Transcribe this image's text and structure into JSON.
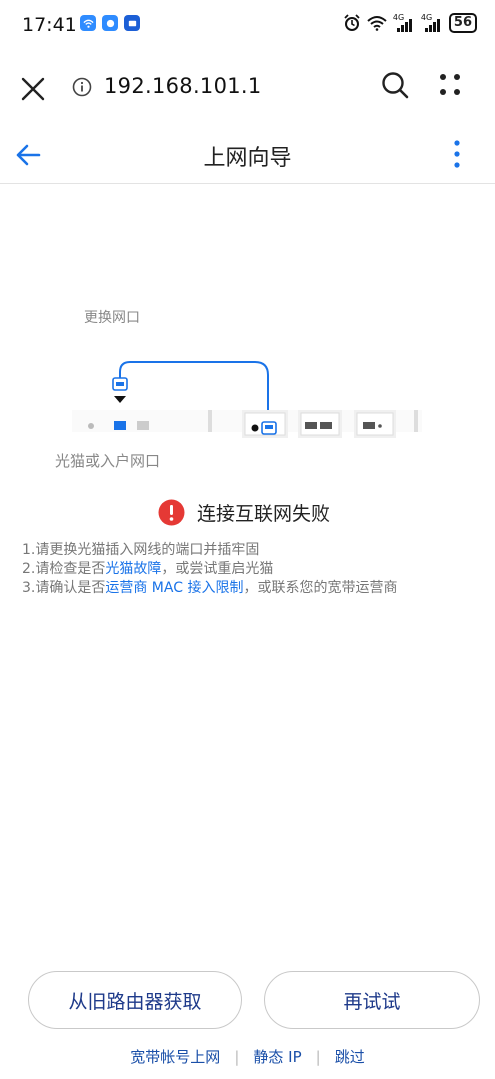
{
  "status_bar": {
    "time": "17:41",
    "signal1_label": "4G",
    "signal2_label": "4G",
    "battery": "56"
  },
  "browser": {
    "url": "192.168.101.1"
  },
  "header": {
    "title": "上网向导"
  },
  "diagram": {
    "label_top": "更换网口",
    "label_bottom": "光猫或入户网口"
  },
  "error": {
    "title": "连接互联网失败",
    "color": "#e53935"
  },
  "tips": {
    "tip1": "1.请更换光猫插入网线的端口并插牢固",
    "tip2_prefix": "2.请检查是否",
    "tip2_link": "光猫故障",
    "tip2_suffix": "，或尝试重启光猫",
    "tip3_prefix": "3.请确认是否",
    "tip3_link": "运营商 MAC 接入限制",
    "tip3_suffix": "，或联系您的宽带运营商"
  },
  "buttons": {
    "old_router": "从旧路由器获取",
    "retry": "再试试"
  },
  "footer": {
    "broadband": "宽带帐号上网",
    "sep1": "|",
    "static_ip": "静态 IP",
    "sep2": "|",
    "skip": "跳过"
  },
  "colors": {
    "accent": "#1a73e8",
    "link_dark": "#1e3a8a"
  },
  "icons": [
    "close-icon",
    "info-icon",
    "search-icon",
    "more-dots-icon",
    "back-arrow-icon",
    "more-vertical-icon",
    "error-icon"
  ]
}
